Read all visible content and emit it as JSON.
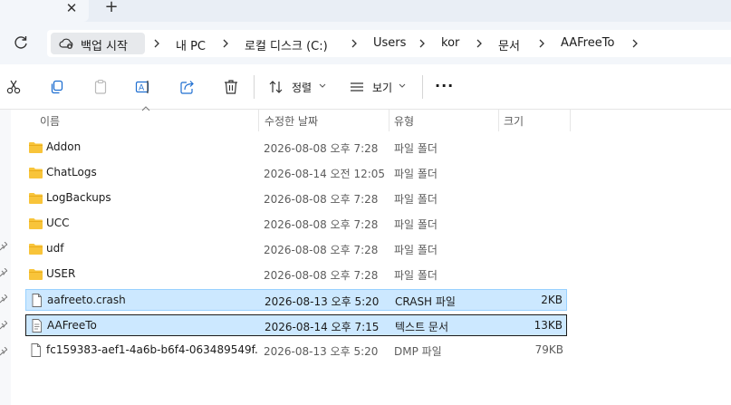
{
  "tabs": {
    "close_glyph": "✕",
    "new_glyph": "+"
  },
  "address": {
    "backup_label": "백업 시작",
    "breadcrumbs": [
      "내 PC",
      "로컬 디스크 (C:)",
      "Users",
      "kor",
      "문서",
      "AAFreeTo"
    ]
  },
  "toolbar": {
    "sort_label": "정렬",
    "view_label": "보기",
    "more_label": "···"
  },
  "columns": {
    "name": "이름",
    "date": "수정한 날짜",
    "type": "유형",
    "size": "크기"
  },
  "files": [
    {
      "name": "Addon",
      "date": "2026-08-08 오후 7:28",
      "type": "파일 폴더",
      "size": "",
      "icon": "folder-icon"
    },
    {
      "name": "ChatLogs",
      "date": "2026-08-14 오전 12:05",
      "type": "파일 폴더",
      "size": "",
      "icon": "folder-icon"
    },
    {
      "name": "LogBackups",
      "date": "2026-08-08 오후 7:28",
      "type": "파일 폴더",
      "size": "",
      "icon": "folder-icon"
    },
    {
      "name": "UCC",
      "date": "2026-08-08 오후 7:28",
      "type": "파일 폴더",
      "size": "",
      "icon": "folder-icon"
    },
    {
      "name": "udf",
      "date": "2026-08-08 오후 7:28",
      "type": "파일 폴더",
      "size": "",
      "icon": "folder-icon"
    },
    {
      "name": "USER",
      "date": "2026-08-08 오후 7:28",
      "type": "파일 폴더",
      "size": "",
      "icon": "folder-icon"
    },
    {
      "name": "aafreeto.crash",
      "date": "2026-08-13 오후 5:20",
      "type": "CRASH 파일",
      "size": "2KB",
      "icon": "file-icon",
      "selected": true
    },
    {
      "name": "AAFreeTo",
      "date": "2026-08-14 오후 7:15",
      "type": "텍스트 문서",
      "size": "13KB",
      "icon": "text-file-icon",
      "selected": true,
      "focused": true
    },
    {
      "name": "fc159383-aef1-4a6b-b6f4-063489549f...",
      "date": "2026-08-13 오후 5:20",
      "type": "DMP 파일",
      "size": "79KB",
      "icon": "file-icon"
    }
  ],
  "colors": {
    "selection": "#cce8ff",
    "selection_border": "#99d1ff",
    "folder": "#f8c43a"
  }
}
